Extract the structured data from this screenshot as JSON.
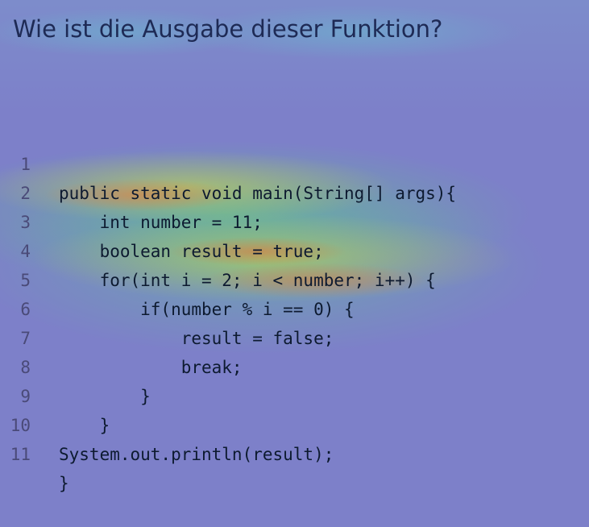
{
  "title": "Wie ist die Ausgabe dieser Funktion?",
  "code": {
    "lines": [
      {
        "number": "1",
        "text": "public static void main(String[] args){"
      },
      {
        "number": "2",
        "text": "    int number = 11;"
      },
      {
        "number": "3",
        "text": "    boolean result = true;"
      },
      {
        "number": "4",
        "text": "    for(int i = 2; i < number; i++) {"
      },
      {
        "number": "5",
        "text": "        if(number % i == 0) {"
      },
      {
        "number": "6",
        "text": "            result = false;"
      },
      {
        "number": "7",
        "text": "            break;"
      },
      {
        "number": "8",
        "text": "        }"
      },
      {
        "number": "9",
        "text": "    }"
      },
      {
        "number": "10",
        "text": "System.out.println(result);"
      },
      {
        "number": "11",
        "text": "}"
      }
    ]
  },
  "colors": {
    "background": "#7d80c9",
    "title": "#1e2a55",
    "code_text": "#0d1a30",
    "line_number": "#4a4a78",
    "heat_high": "#e0783c",
    "heat_mid": "#d2d746",
    "heat_low": "#5acd82"
  }
}
